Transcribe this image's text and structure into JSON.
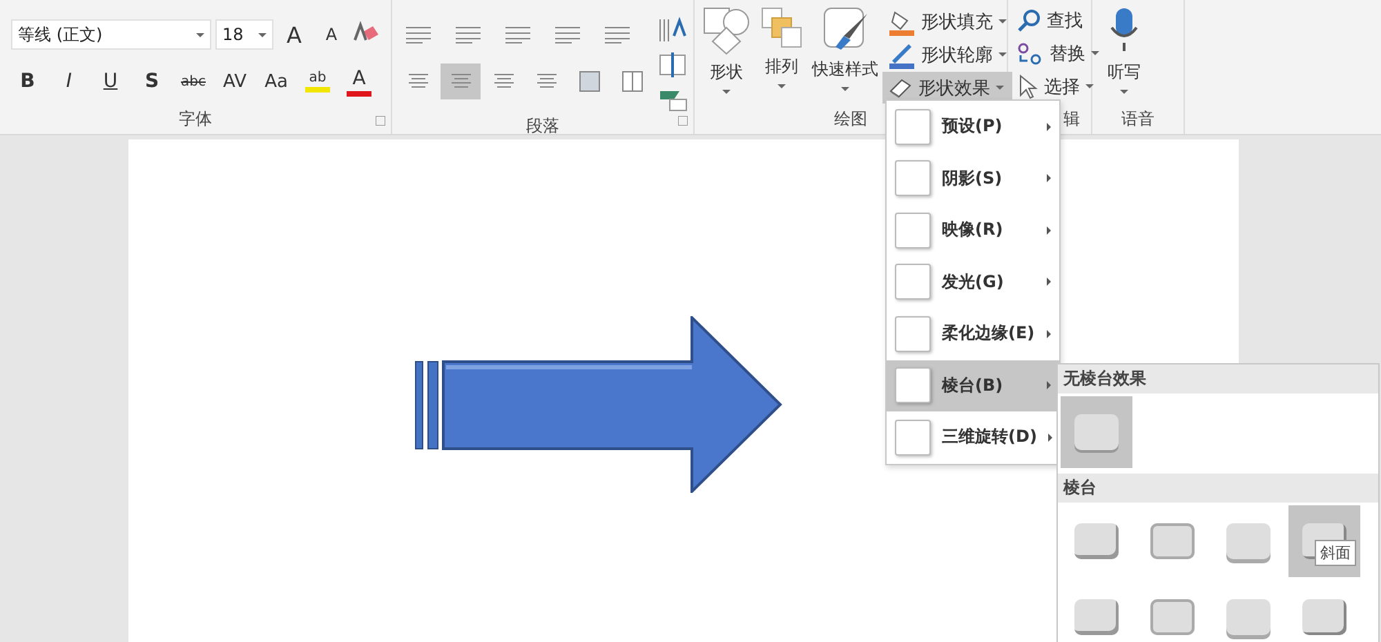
{
  "font_group": {
    "font_name": "等线 (正文)",
    "font_size": "18",
    "size_buttons": [
      {
        "label": "A",
        "kind": "grow"
      },
      {
        "label": "A",
        "kind": "shrink"
      }
    ],
    "format_buttons": [
      {
        "label": "B",
        "kind": "bold"
      },
      {
        "label": "I",
        "kind": "italic"
      },
      {
        "label": "U",
        "kind": "underline"
      },
      {
        "label": "S",
        "kind": "shadow"
      },
      {
        "label": "abc",
        "kind": "strike"
      },
      {
        "label": "AV",
        "kind": "spacing"
      },
      {
        "label": "Aa",
        "kind": "case"
      }
    ],
    "color_buttons": [
      {
        "label": "ab",
        "color": "#f2e600"
      },
      {
        "label": "A",
        "color": "#e0161b"
      }
    ],
    "label": "字体"
  },
  "paragraph_group": {
    "alignments": [
      {
        "selected": false
      },
      {
        "selected": true
      },
      {
        "selected": false
      },
      {
        "selected": false
      }
    ],
    "label": "段落"
  },
  "drawing_group": {
    "buttons": [
      {
        "label": "形状",
        "kind": "shapes"
      },
      {
        "label": "排列",
        "kind": "arrange"
      },
      {
        "label": "快速样式",
        "kind": "styles"
      }
    ],
    "shape_commands": [
      {
        "label": "形状填充",
        "kind": "fill",
        "selected": false
      },
      {
        "label": "形状轮廓",
        "kind": "outline",
        "selected": false
      },
      {
        "label": "形状效果",
        "kind": "effects",
        "selected": true
      }
    ],
    "label": "绘图"
  },
  "editing_group": {
    "commands": [
      {
        "label": "查找",
        "kind": "find"
      },
      {
        "label": "替换",
        "kind": "replace"
      },
      {
        "label": "选择",
        "kind": "select"
      }
    ],
    "label": "辑"
  },
  "voice_group": {
    "button": "听写",
    "label": "语音"
  },
  "effects_menu": {
    "items": [
      {
        "label": "预设(P)",
        "selected": false
      },
      {
        "label": "阴影(S)",
        "selected": false
      },
      {
        "label": "映像(R)",
        "selected": false
      },
      {
        "label": "发光(G)",
        "selected": false
      },
      {
        "label": "柔化边缘(E)",
        "selected": false
      },
      {
        "label": "棱台(B)",
        "selected": true
      },
      {
        "label": "三维旋转(D)",
        "selected": false
      }
    ]
  },
  "bevel_submenu": {
    "sections": [
      {
        "title": "无棱台效果",
        "items": [
          {
            "selected": true
          }
        ]
      },
      {
        "title": "棱台",
        "items": [
          {
            "selected": false
          },
          {
            "selected": false
          },
          {
            "selected": false
          },
          {
            "selected": true
          },
          {
            "selected": false
          },
          {
            "selected": false
          },
          {
            "selected": false
          },
          {
            "selected": false
          }
        ]
      }
    ],
    "tooltip": "斜面"
  }
}
